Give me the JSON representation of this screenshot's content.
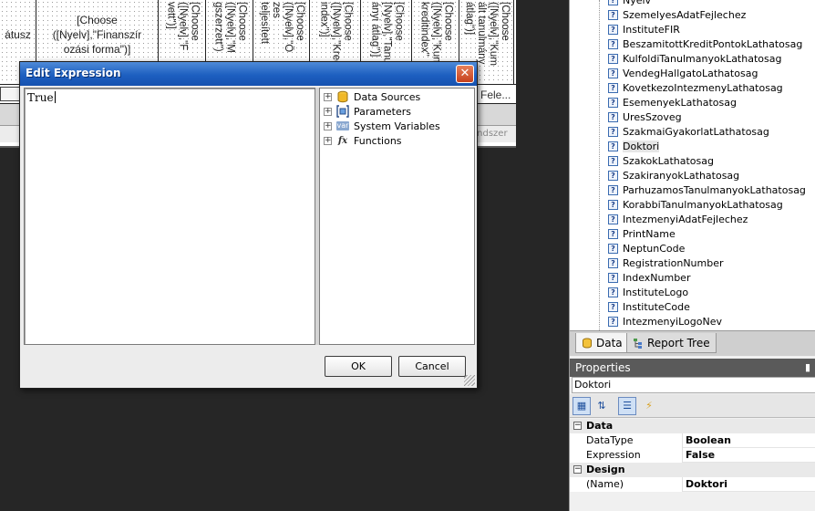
{
  "report": {
    "columns": [
      {
        "text": "átusz",
        "type": "h"
      },
      {
        "text": "[Choose\n([Nyelv],\"Finanszír\nozási forma\")]",
        "type": "h"
      },
      {
        "text": "[Choose\n([Nyelv],\"F\nvett\")]",
        "type": "v"
      },
      {
        "text": "[Choose\n([Nyelv],\"M\ngszerzett\")",
        "type": "v"
      },
      {
        "text": "[Choose\n([Nyelv],\"Ö\nzes\nteljesített",
        "type": "v"
      },
      {
        "text": "[Choose\n([Nyelv],\"Kredi\nindex\")]",
        "type": "v"
      },
      {
        "text": "[Choose\n[Nyelv],\"Tanu\nányi átlag\")]",
        "type": "v"
      },
      {
        "text": "[Choose\n([Nyelv],\"Kum\nkreditindex\"",
        "type": "v"
      },
      {
        "text": "[Choose\n([Nyelv],\"Kum\nált tanulmány\nátlag\")]",
        "type": "v"
      }
    ],
    "band_text": "Fele...",
    "band_text2": "endszer"
  },
  "data_tree": {
    "items": [
      "Nyelv",
      "SzemelyesAdatFejlechez",
      "InstituteFIR",
      "BeszamitottKreditPontokLathatosag",
      "KulfoldiTanulmanyokLathatosag",
      "VendegHallgatoLathatosag",
      "KovetkezoIntezmenyLathatosag",
      "EsemenyekLathatosag",
      "UresSzoveg",
      "SzakmaiGyakorlatLathatosag",
      "Doktori",
      "SzakokLathatosag",
      "SzakiranyokLathatosag",
      "ParhuzamosTanulmanyokLathatosag",
      "KorabbiTanulmanyokLathatosag",
      "IntezmenyiAdatFejlechez",
      "PrintName",
      "NeptunCode",
      "RegistrationNumber",
      "IndexNumber",
      "InstituteLogo",
      "InstituteCode",
      "IntezmenyiLogoNev"
    ],
    "selected": "Doktori",
    "item_icon": "variable-icon",
    "item_icon_glyph": "?"
  },
  "panel_tabs": {
    "data": "Data",
    "report_tree": "Report Tree"
  },
  "properties": {
    "title": "Properties",
    "object": "Doktori",
    "categories": [
      {
        "name": "Data",
        "rows": [
          {
            "name": "DataType",
            "value": "Boolean"
          },
          {
            "name": "Expression",
            "value": "False"
          }
        ]
      },
      {
        "name": "Design",
        "rows": [
          {
            "name": "(Name)",
            "value": "Doktori"
          }
        ]
      }
    ],
    "toolbar_icons": [
      "categorized-icon",
      "alphabetical-icon",
      "properties-icon",
      "events-icon"
    ]
  },
  "dialog": {
    "title": "Edit Expression",
    "expression": "True",
    "dictionary": [
      {
        "label": "Data Sources",
        "icon": "database-icon"
      },
      {
        "label": "Parameters",
        "icon": "parameters-icon"
      },
      {
        "label": "System Variables",
        "icon": "system-variables-icon",
        "glyph": "var"
      },
      {
        "label": "Functions",
        "icon": "functions-icon",
        "glyph": "fx"
      }
    ],
    "ok_label": "OK",
    "cancel_label": "Cancel"
  },
  "colors": {
    "titlebar": "#1d5fc0",
    "close_button": "#c6401d",
    "background": "#262626"
  }
}
